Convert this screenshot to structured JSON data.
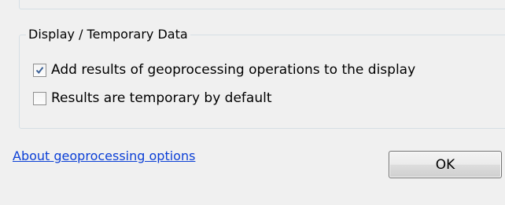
{
  "display_group": {
    "title": "Display / Temporary Data",
    "options": [
      {
        "label": "Add results of geoprocessing operations to the display",
        "checked": true
      },
      {
        "label": "Results are temporary by default",
        "checked": false
      }
    ]
  },
  "footer": {
    "help_link": "About geoprocessing options",
    "ok_label": "OK"
  }
}
